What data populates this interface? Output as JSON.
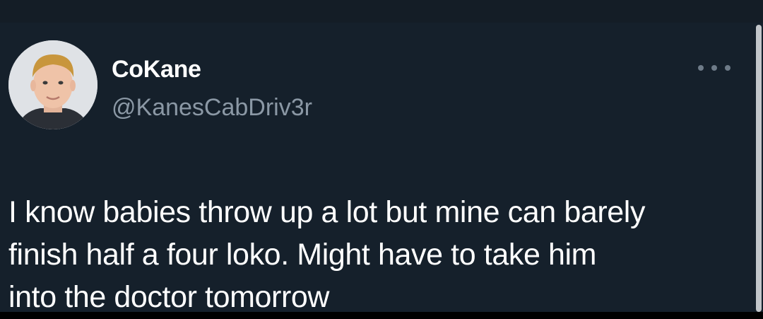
{
  "user": {
    "display_name": "CoKane",
    "handle": "@KanesCabDriv3r",
    "avatar_icon": "profile-photo"
  },
  "tweet": {
    "text": "I know babies throw up a lot but mine can barely\nfinish half a four loko. Might have to take him\ninto the doctor tomorrow"
  },
  "more_icon": "more-horizontal-icon",
  "colors": {
    "background": "#15202b",
    "text": "#ffffff",
    "secondary_text": "#8b98a5"
  }
}
